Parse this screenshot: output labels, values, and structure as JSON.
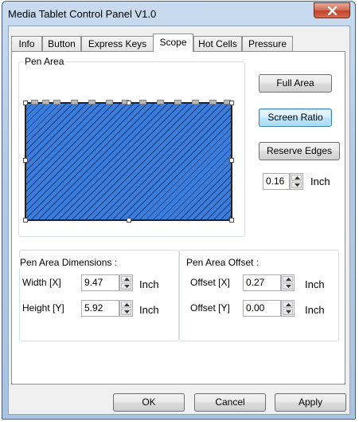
{
  "window": {
    "title": "Media Tablet Control Panel V1.0"
  },
  "tabs": [
    {
      "label": "Info"
    },
    {
      "label": "Button"
    },
    {
      "label": "Express Keys"
    },
    {
      "label": "Scope",
      "active": true
    },
    {
      "label": "Hot Cells"
    },
    {
      "label": "Pressure"
    }
  ],
  "pen_area": {
    "caption": "Pen Area",
    "full_area_label": "Full Area",
    "screen_ratio_label": "Screen Ratio",
    "reserve_edges_label": "Reserve Edges",
    "reserve_value": "0.16",
    "reserve_unit": "Inch"
  },
  "dimensions": {
    "caption": "Pen Area Dimensions :",
    "width_label": "Width [X]",
    "width_value": "9.47",
    "width_unit": "Inch",
    "height_label": "Height [Y]",
    "height_value": "5.92",
    "height_unit": "Inch"
  },
  "offset": {
    "caption": "Pen Area Offset :",
    "x_label": "Offset [X]",
    "x_value": "0.27",
    "x_unit": "Inch",
    "y_label": "Offset [Y]",
    "y_value": "0.00",
    "y_unit": "Inch"
  },
  "buttons": {
    "ok": "OK",
    "cancel": "Cancel",
    "apply": "Apply"
  },
  "colors": {
    "pen_area_fill": "#2f6ecf",
    "focus_blue": "#3c7fb1",
    "close_red": "#c0432a"
  }
}
